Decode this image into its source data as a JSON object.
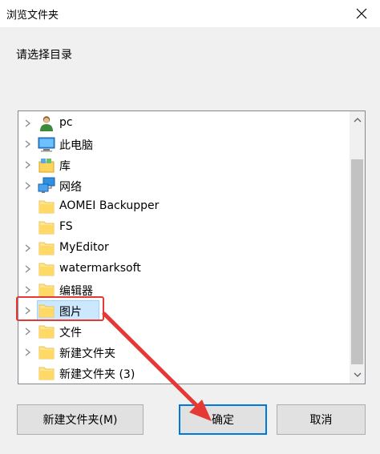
{
  "window": {
    "title": "浏览文件夹",
    "close_icon": "close-icon"
  },
  "prompt": "请选择目录",
  "tree": {
    "items": [
      {
        "label": "pc",
        "icon": "user-icon",
        "expandable": true
      },
      {
        "label": "此电脑",
        "icon": "computer-icon",
        "expandable": true
      },
      {
        "label": "库",
        "icon": "library-icon",
        "expandable": true
      },
      {
        "label": "网络",
        "icon": "network-icon",
        "expandable": true
      },
      {
        "label": "AOMEI Backupper",
        "icon": "folder-icon",
        "expandable": false
      },
      {
        "label": "FS",
        "icon": "folder-icon",
        "expandable": false
      },
      {
        "label": "MyEditor",
        "icon": "folder-icon",
        "expandable": true
      },
      {
        "label": "watermarksoft",
        "icon": "folder-icon",
        "expandable": true
      },
      {
        "label": "编辑器",
        "icon": "folder-icon",
        "expandable": true
      },
      {
        "label": "图片",
        "icon": "folder-icon",
        "expandable": true,
        "selected": true
      },
      {
        "label": "文件",
        "icon": "folder-icon",
        "expandable": true
      },
      {
        "label": "新建文件夹",
        "icon": "folder-icon",
        "expandable": true
      },
      {
        "label": "新建文件夹 (3)",
        "icon": "folder-icon",
        "expandable": false
      }
    ]
  },
  "buttons": {
    "new_folder": "新建文件夹(M)",
    "ok": "确定",
    "cancel": "取消"
  },
  "colors": {
    "selection": "#cce8ff",
    "annotation": "#e53935",
    "default_button_border": "#0078d7"
  }
}
